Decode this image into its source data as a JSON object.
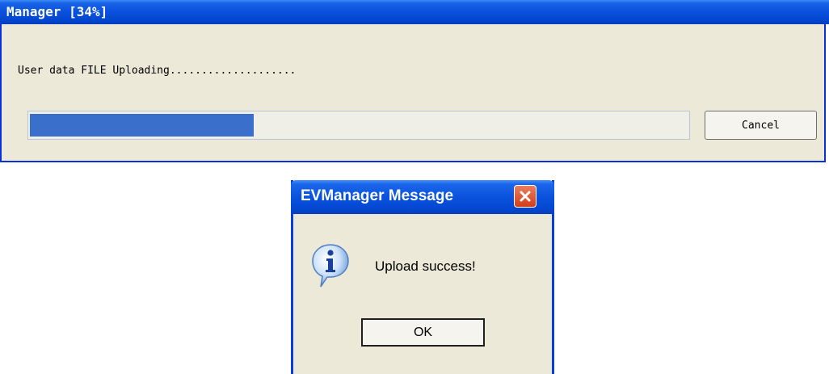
{
  "progress_window": {
    "title": "Manager [34%]",
    "status_text": "User data FILE Uploading....................",
    "progress_percent": 34,
    "cancel_label": "Cancel"
  },
  "message_dialog": {
    "title": "EVManager Message",
    "message": "Upload success!",
    "ok_label": "OK",
    "icon": "info-icon"
  },
  "colors": {
    "titlebar": "#0a52dd",
    "progress_fill": "#3a6fcb",
    "window_bg": "#ece9d8",
    "close_button": "#d43d17"
  }
}
